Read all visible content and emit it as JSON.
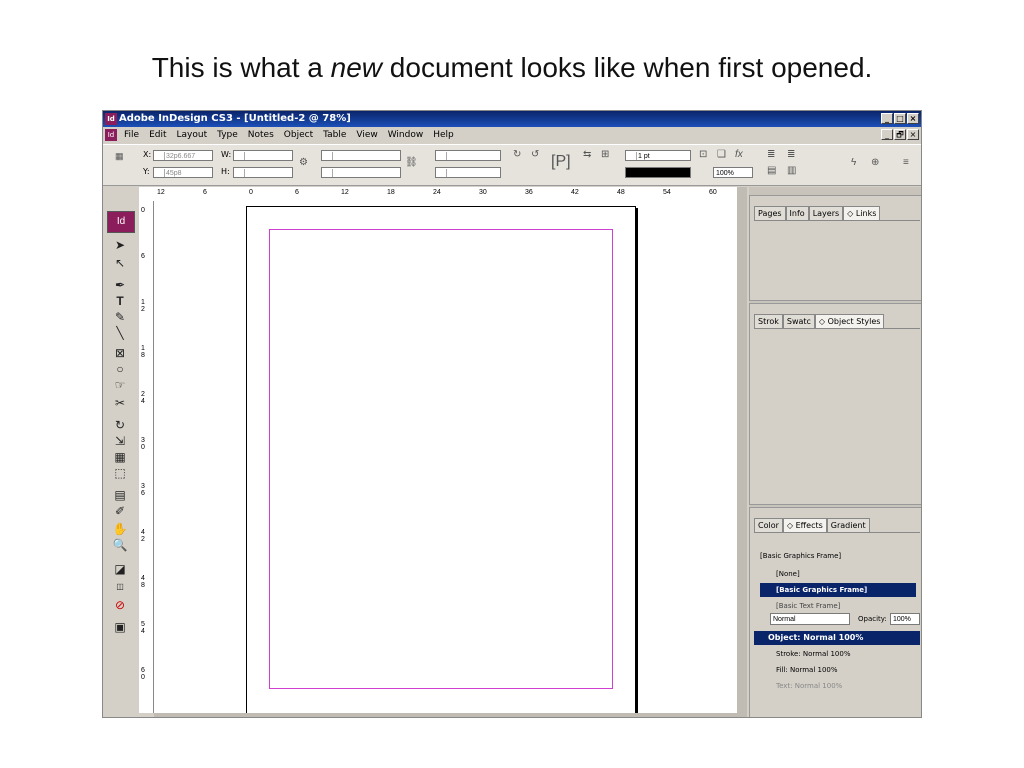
{
  "slide": {
    "title_before": "This is what a ",
    "title_italic": "new",
    "title_after": " document looks like when first opened."
  },
  "window": {
    "title": "Adobe InDesign CS3 - [Untitled-2 @ 78%]",
    "app_icon": "Id",
    "minimize": "_",
    "maximize": "□",
    "restore": "🗗",
    "close": "×"
  },
  "menu": [
    "File",
    "Edit",
    "Layout",
    "Type",
    "Notes",
    "Object",
    "Table",
    "View",
    "Window",
    "Help"
  ],
  "control": {
    "x_label": "X:",
    "x_value": "32p6.667",
    "y_label": "Y:",
    "y_value": "45p8",
    "w_label": "W:",
    "h_label": "H:",
    "stroke_weight": "1 pt",
    "zoom": "100%"
  },
  "ruler_h": [
    "12",
    "6",
    "0",
    "6",
    "12",
    "18",
    "24",
    "30",
    "36",
    "42",
    "48",
    "54",
    "60"
  ],
  "ruler_v": [
    "0",
    "6",
    "1 2",
    "1 8",
    "2 4",
    "3 0",
    "3 6",
    "4 2",
    "4 8",
    "5 4",
    "6 0"
  ],
  "panels": {
    "top_tabs": [
      "Pages",
      "Info",
      "Layers",
      "◇ Links"
    ],
    "mid_tabs": [
      "Strok",
      "Swatc",
      "◇ Object Styles"
    ],
    "bottom_tabs": [
      "Color",
      "◇ Effects",
      "Gradient"
    ],
    "object_styles": {
      "current": "[Basic Graphics Frame]",
      "items": [
        "[None]",
        "[Basic Graphics Frame]",
        "[Basic Text Frame]"
      ]
    },
    "effects": {
      "blend_mode": "Normal",
      "opacity_label": "Opacity:",
      "opacity": "100%",
      "object_row": "Object: Normal 100%",
      "stroke_row_label": "Stroke:",
      "stroke_row_value": "Normal 100%",
      "fill_row_label": "Fill:",
      "fill_row_value": "Normal 100%",
      "text_row_label": "Text:",
      "text_row_value": "Normal 100%"
    }
  },
  "colors": {
    "titlebar": "#0a246a",
    "margin_guide": "#d040d0",
    "brand": "#8c1d5d"
  }
}
